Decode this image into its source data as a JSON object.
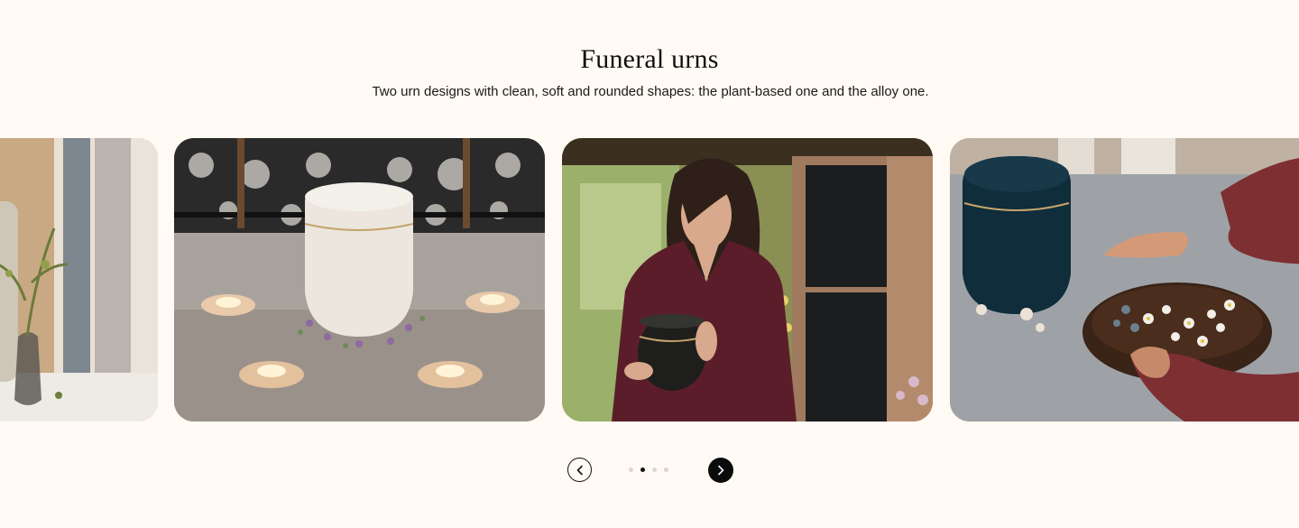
{
  "section": {
    "title": "Funeral urns",
    "subtitle": "Two urn designs with clean, soft and rounded shapes: the plant-based one and the alloy one."
  },
  "carousel": {
    "slides": [
      {
        "image": "vase-with-plants-by-window"
      },
      {
        "image": "cream-urn-with-candles"
      },
      {
        "image": "woman-holding-dark-urn"
      },
      {
        "image": "navy-urn-with-flower-bowl"
      }
    ],
    "dots": 4,
    "active_dot": 1,
    "prev_icon": "chevron-left-icon",
    "next_icon": "chevron-right-icon"
  },
  "colors": {
    "background": "#fffaf3",
    "accent": "#0b0b0b",
    "dot_inactive": "#d9d6d0"
  }
}
